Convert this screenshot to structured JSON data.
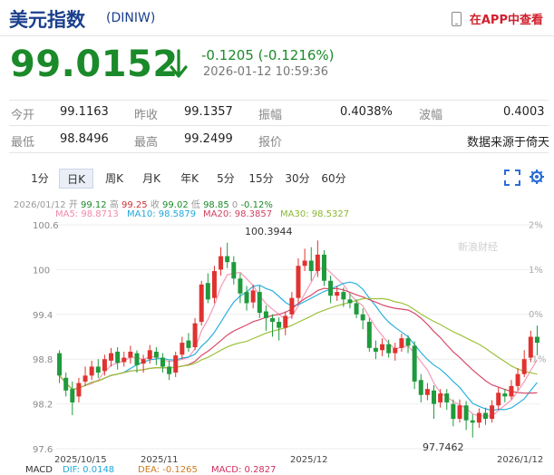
{
  "header": {
    "title": "美元指数",
    "code": "(DINIW)",
    "app_link": "在APP中查看"
  },
  "quote": {
    "price": "99.0152",
    "change": "-0.1205 (-0.1216%)",
    "timestamp": "2026-01-12 10:59:36",
    "direction": "down",
    "color": "#1b8a2a"
  },
  "stats": {
    "row1": [
      {
        "label": "今开",
        "value": "99.1163"
      },
      {
        "label": "昨收",
        "value": "99.1357"
      },
      {
        "label": "振幅",
        "value": "0.4038%"
      },
      {
        "label": "波幅",
        "value": "0.4003"
      }
    ],
    "row2": [
      {
        "label": "最低",
        "value": "98.8496"
      },
      {
        "label": "最高",
        "value": "99.2499"
      },
      {
        "label": "报价",
        "value": "数据来源于倚天"
      }
    ]
  },
  "tabs": [
    "1分",
    "日K",
    "周K",
    "月K",
    "年K",
    "5分",
    "15分",
    "30分",
    "60分"
  ],
  "active_tab": "日K",
  "bar_info": {
    "date": "2026/01/12",
    "open_label": "开",
    "open": "99.12",
    "high_label": "高",
    "high": "99.25",
    "close_label": "收",
    "close": "99.02",
    "low_label": "低",
    "low": "98.85",
    "vol_label": "0",
    "pct": "-0.12%"
  },
  "ma": {
    "ma5": "MA5: 98.8713",
    "ma10": "MA10: 98.5879",
    "ma20": "MA20: 98.3857",
    "ma30": "MA30: 98.5327"
  },
  "watermark": "新浪财经",
  "chart_data": {
    "type": "candlestick",
    "y_ticks": [
      "100.6",
      "100",
      "99.4",
      "98.8",
      "98.2",
      "97.6"
    ],
    "y_right_ticks": [
      "2%",
      "1%",
      "0%",
      "-1%"
    ],
    "x_ticks": [
      "2025/10/15",
      "2025/11",
      "2025/12",
      "2026/1/12"
    ],
    "annotations": {
      "high": "100.3944",
      "low": "97.7462"
    },
    "ylim": [
      97.6,
      100.6
    ],
    "candles": [
      [
        98.88,
        98.58,
        98.92,
        98.48
      ],
      [
        98.55,
        98.38,
        98.62,
        98.3
      ],
      [
        98.4,
        98.22,
        98.5,
        98.05
      ],
      [
        98.3,
        98.48,
        98.55,
        98.22
      ],
      [
        98.5,
        98.58,
        98.7,
        98.44
      ],
      [
        98.58,
        98.7,
        98.78,
        98.52
      ],
      [
        98.7,
        98.62,
        98.8,
        98.55
      ],
      [
        98.64,
        98.8,
        98.86,
        98.58
      ],
      [
        98.78,
        98.88,
        98.95,
        98.7
      ],
      [
        98.9,
        98.75,
        98.96,
        98.66
      ],
      [
        98.76,
        98.82,
        98.9,
        98.7
      ],
      [
        98.82,
        98.9,
        98.98,
        98.74
      ],
      [
        98.88,
        98.72,
        98.92,
        98.62
      ],
      [
        98.74,
        98.8,
        98.86,
        98.62
      ],
      [
        98.8,
        98.92,
        98.99,
        98.74
      ],
      [
        98.9,
        98.82,
        98.96,
        98.72
      ],
      [
        98.82,
        98.7,
        98.88,
        98.62
      ],
      [
        98.7,
        98.6,
        98.78,
        98.52
      ],
      [
        98.62,
        98.85,
        98.9,
        98.56
      ],
      [
        98.86,
        99.02,
        99.1,
        98.8
      ],
      [
        99.05,
        98.95,
        99.15,
        98.9
      ],
      [
        98.96,
        99.28,
        99.35,
        98.92
      ],
      [
        99.3,
        99.8,
        99.85,
        99.25
      ],
      [
        99.82,
        99.6,
        99.95,
        99.55
      ],
      [
        99.62,
        99.98,
        100.05,
        99.55
      ],
      [
        100.0,
        100.18,
        100.3,
        99.92
      ],
      [
        100.18,
        100.1,
        100.36,
        100.02
      ],
      [
        100.1,
        99.88,
        100.18,
        99.8
      ],
      [
        99.88,
        99.68,
        99.95,
        99.55
      ],
      [
        99.7,
        99.55,
        99.78,
        99.45
      ],
      [
        99.56,
        99.72,
        99.8,
        99.48
      ],
      [
        99.7,
        99.42,
        99.78,
        99.35
      ],
      [
        99.44,
        99.35,
        99.52,
        99.18
      ],
      [
        99.35,
        99.3,
        99.4,
        99.1
      ],
      [
        99.3,
        99.22,
        99.36,
        99.05
      ],
      [
        99.22,
        99.38,
        99.44,
        99.12
      ],
      [
        99.4,
        99.62,
        99.7,
        99.34
      ],
      [
        99.62,
        100.05,
        100.15,
        99.55
      ],
      [
        100.05,
        100.12,
        100.28,
        99.98
      ],
      [
        100.12,
        99.98,
        100.3,
        99.85
      ],
      [
        99.98,
        100.2,
        100.39,
        99.9
      ],
      [
        100.2,
        99.85,
        100.26,
        99.78
      ],
      [
        99.85,
        99.65,
        99.92,
        99.55
      ],
      [
        99.65,
        99.7,
        99.78,
        99.58
      ],
      [
        99.7,
        99.6,
        99.76,
        99.5
      ],
      [
        99.6,
        99.55,
        99.68,
        99.48
      ],
      [
        99.55,
        99.4,
        99.6,
        99.35
      ],
      [
        99.4,
        99.32,
        99.48,
        99.2
      ],
      [
        99.3,
        98.95,
        99.35,
        98.9
      ],
      [
        98.95,
        98.9,
        99.05,
        98.8
      ],
      [
        98.92,
        99.0,
        99.08,
        98.84
      ],
      [
        99.0,
        98.88,
        99.06,
        98.82
      ],
      [
        98.88,
        98.95,
        99.02,
        98.78
      ],
      [
        98.95,
        99.08,
        99.14,
        98.9
      ],
      [
        99.08,
        98.98,
        99.12,
        98.88
      ],
      [
        98.98,
        98.5,
        99.04,
        98.4
      ],
      [
        98.52,
        98.32,
        98.6,
        98.22
      ],
      [
        98.32,
        98.4,
        98.48,
        98.25
      ],
      [
        98.38,
        98.2,
        98.45,
        98.0
      ],
      [
        98.22,
        98.34,
        98.4,
        98.15
      ],
      [
        98.34,
        98.22,
        98.4,
        98.12
      ],
      [
        98.2,
        98.0,
        98.26,
        97.9
      ],
      [
        98.0,
        98.18,
        98.26,
        97.95
      ],
      [
        98.18,
        97.98,
        98.24,
        97.85
      ],
      [
        97.98,
        97.95,
        98.06,
        97.75
      ],
      [
        97.95,
        98.08,
        98.14,
        97.88
      ],
      [
        98.08,
        98.0,
        98.15,
        97.92
      ],
      [
        98.0,
        98.18,
        98.25,
        97.95
      ],
      [
        98.18,
        98.35,
        98.42,
        98.12
      ],
      [
        98.34,
        98.3,
        98.4,
        98.22
      ],
      [
        98.3,
        98.44,
        98.52,
        98.26
      ],
      [
        98.44,
        98.6,
        98.68,
        98.38
      ],
      [
        98.6,
        98.8,
        98.92,
        98.56
      ],
      [
        98.82,
        99.1,
        99.18,
        98.76
      ],
      [
        99.1,
        99.02,
        99.25,
        98.85
      ]
    ]
  },
  "macd": {
    "label": "MACD",
    "dif": "DIF: 0.0148",
    "dea": "DEA: -0.1265",
    "macd": "MACD: 0.2827"
  }
}
